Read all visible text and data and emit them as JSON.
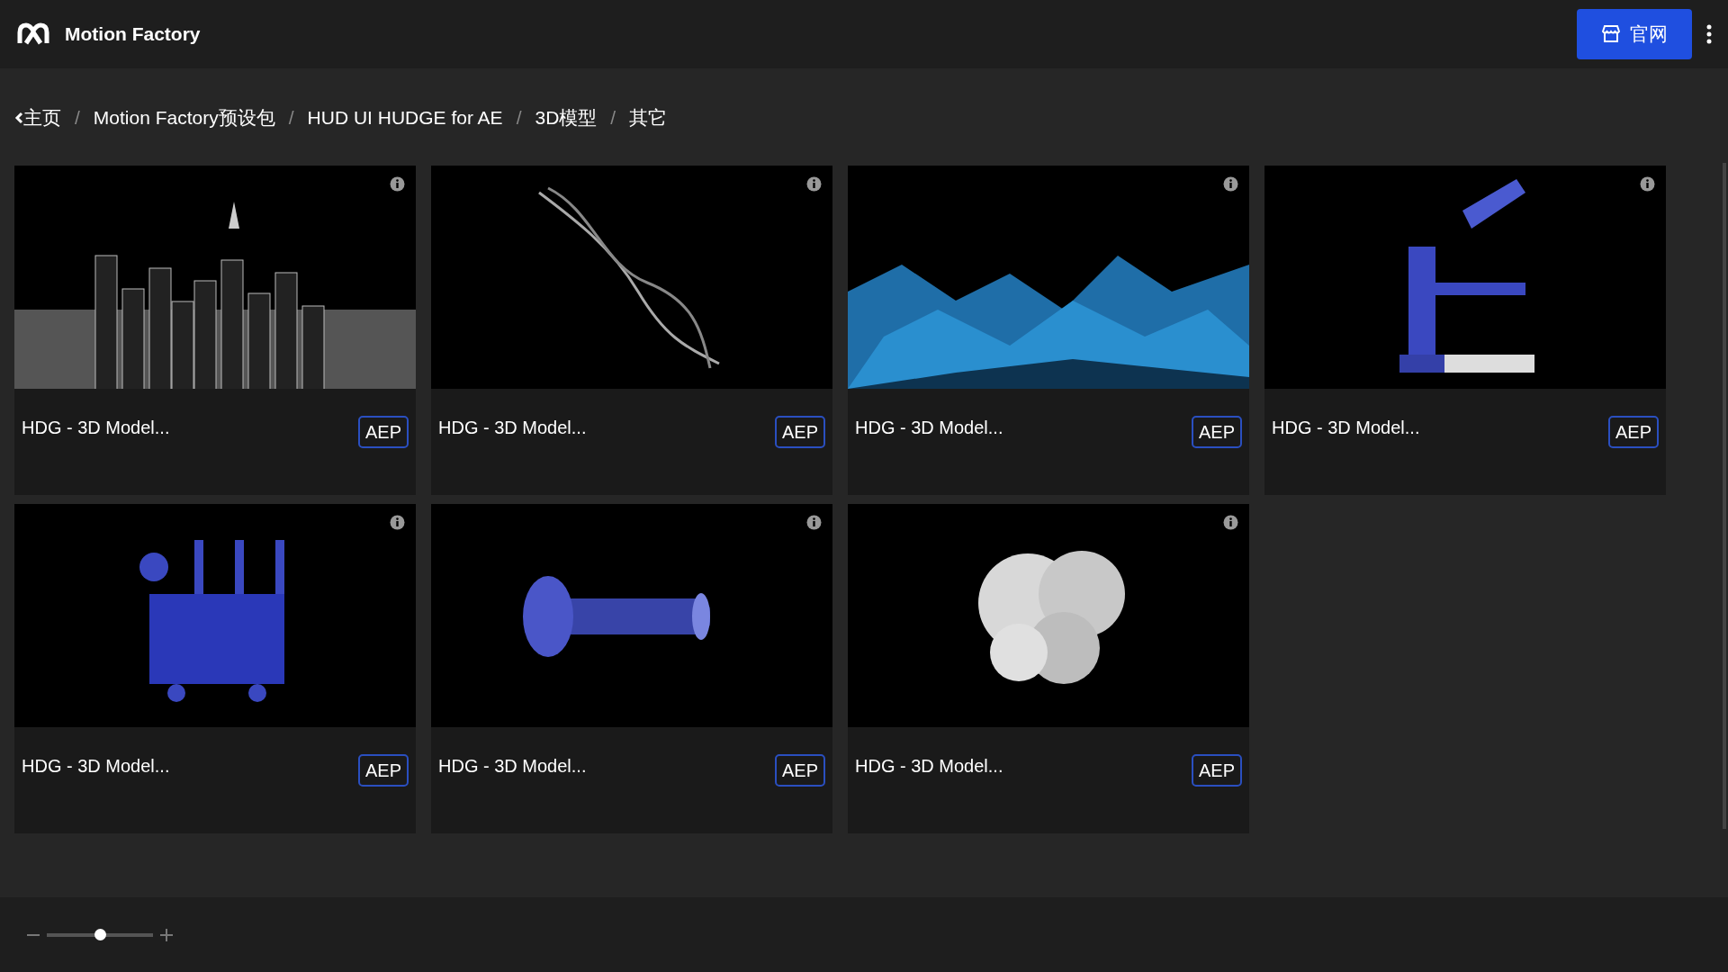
{
  "header": {
    "title": "Motion Factory",
    "button": "官网"
  },
  "breadcrumb": [
    {
      "label": "主页"
    },
    {
      "label": "Motion Factory预设包"
    },
    {
      "label": "HUD UI HUDGE for AE"
    },
    {
      "label": "3D模型"
    },
    {
      "label": "其它"
    }
  ],
  "separator": "/",
  "cards": [
    {
      "title": "HDG - 3D Model...",
      "badge": "AEP"
    },
    {
      "title": "HDG - 3D Model...",
      "badge": "AEP"
    },
    {
      "title": "HDG - 3D Model...",
      "badge": "AEP"
    },
    {
      "title": "HDG - 3D Model...",
      "badge": "AEP"
    },
    {
      "title": "HDG - 3D Model...",
      "badge": "AEP"
    },
    {
      "title": "HDG - 3D Model...",
      "badge": "AEP"
    },
    {
      "title": "HDG - 3D Model...",
      "badge": "AEP"
    }
  ],
  "zoom": {
    "level": 0.5
  }
}
